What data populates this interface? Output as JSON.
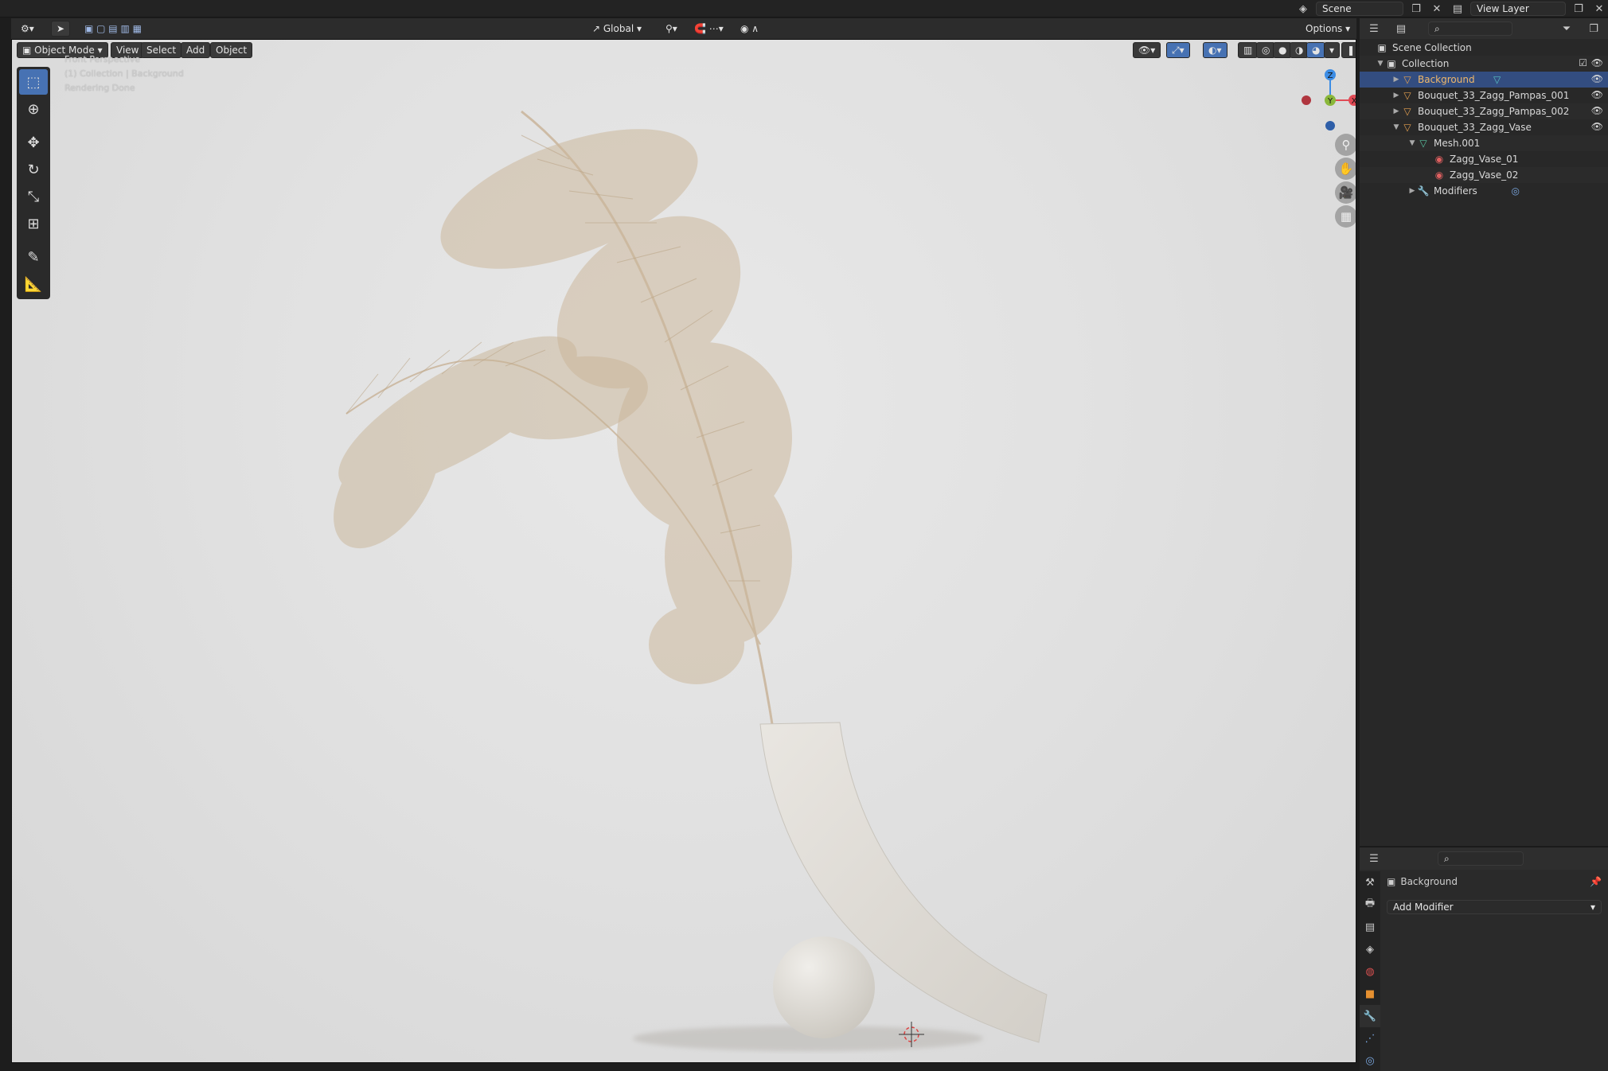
{
  "topbar": {
    "scene_name": "Scene",
    "view_layer_name": "View Layer"
  },
  "viewport_header": {
    "transform_orientation": "Global",
    "options_label": "Options",
    "mode_label": "Object Mode",
    "menu_view": "View",
    "menu_select": "Select",
    "menu_add": "Add",
    "menu_object": "Object"
  },
  "viewport_overlay": {
    "line1": "Front Perspective",
    "line2": "(1) Collection | Background",
    "line3": "Rendering Done"
  },
  "gizmo": {
    "z_label": "Z",
    "y_label": "Y",
    "x_label": "X",
    "colors": {
      "x": "#e14a55",
      "y": "#8ab73a",
      "z": "#3d8de5"
    }
  },
  "outliner": {
    "scene_collection": "Scene Collection",
    "collection": "Collection",
    "items": [
      {
        "label": "Background"
      },
      {
        "label": "Bouquet_33_Zagg_Pampas_001"
      },
      {
        "label": "Bouquet_33_Zagg_Pampas_002"
      },
      {
        "label": "Bouquet_33_Zagg_Vase"
      },
      {
        "label": "Mesh.001"
      },
      {
        "label": "Zagg_Vase_01"
      },
      {
        "label": "Zagg_Vase_02"
      },
      {
        "label": "Modifiers"
      }
    ]
  },
  "properties": {
    "object_name": "Background",
    "add_modifier": "Add Modifier"
  },
  "colors": {
    "accent": "#4772b3",
    "selected_row": "#334d80",
    "viewport_bg": "#e4e4e4"
  }
}
